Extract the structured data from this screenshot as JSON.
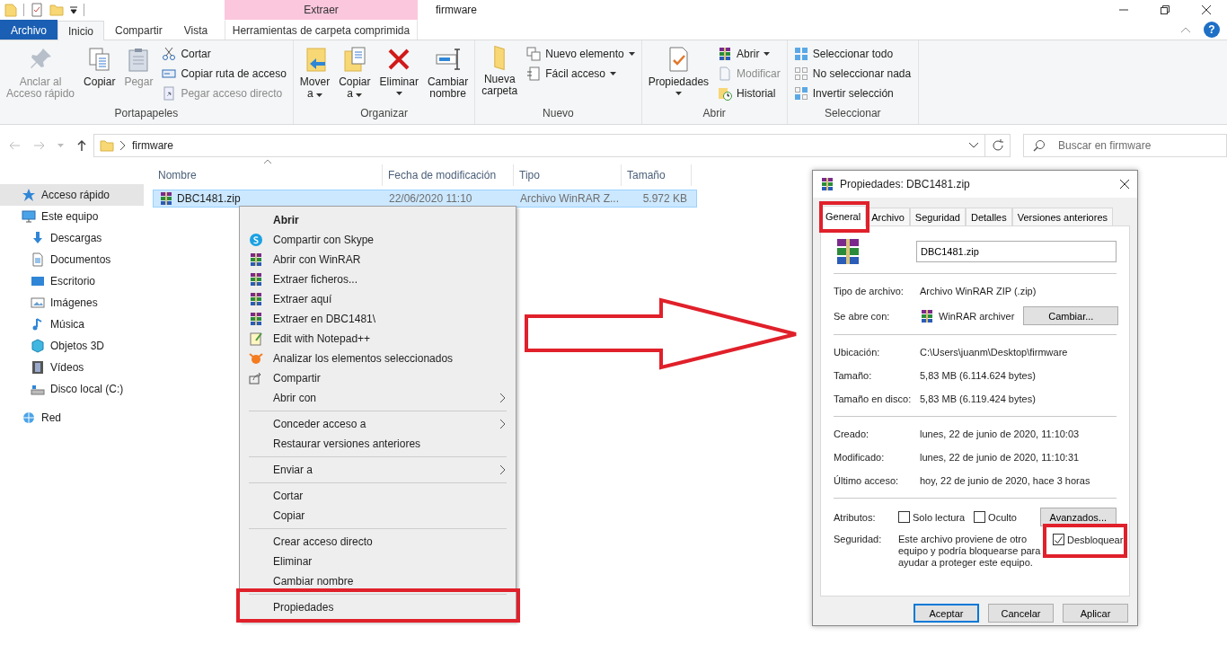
{
  "window": {
    "title": "firmware",
    "tool_tab_group": "Extraer",
    "help_button": "?"
  },
  "ribbon_tabs": [
    {
      "label": "Archivo",
      "kind": "file",
      "selected": false
    },
    {
      "label": "Inicio",
      "kind": "tab",
      "selected": true
    },
    {
      "label": "Compartir",
      "kind": "tab",
      "selected": false
    },
    {
      "label": "Vista",
      "kind": "tab",
      "selected": false
    },
    {
      "label": "Herramientas de carpeta comprimida",
      "kind": "tool",
      "selected": false
    }
  ],
  "ribbon_groups": [
    {
      "name": "Portapapeles",
      "items": [
        {
          "label": "Anclar al\nAcceso rápido",
          "kind": "large",
          "disabled": true,
          "dropdown": false
        },
        {
          "label": "Copiar",
          "kind": "large",
          "disabled": false,
          "dropdown": false
        },
        {
          "label": "Pegar",
          "kind": "large",
          "disabled": true,
          "dropdown": false
        },
        {
          "label": "Cortar",
          "kind": "small",
          "disabled": false,
          "dropdown": false
        },
        {
          "label": "Copiar ruta de acceso",
          "kind": "small",
          "disabled": false,
          "dropdown": false
        },
        {
          "label": "Pegar acceso directo",
          "kind": "small",
          "disabled": true,
          "dropdown": false
        }
      ]
    },
    {
      "name": "Organizar",
      "items": [
        {
          "label": "Mover\na",
          "kind": "large",
          "disabled": false,
          "dropdown": true
        },
        {
          "label": "Copiar\na",
          "kind": "large",
          "disabled": false,
          "dropdown": true
        },
        {
          "label": "Eliminar",
          "kind": "large",
          "disabled": false,
          "dropdown": true
        },
        {
          "label": "Cambiar\nnombre",
          "kind": "large",
          "disabled": false,
          "dropdown": false
        }
      ]
    },
    {
      "name": "Nuevo",
      "items": [
        {
          "label": "Nueva\ncarpeta",
          "kind": "large",
          "disabled": false,
          "dropdown": false
        },
        {
          "label": "Nuevo elemento",
          "kind": "small",
          "disabled": false,
          "dropdown": true
        },
        {
          "label": "Fácil acceso",
          "kind": "small",
          "disabled": false,
          "dropdown": true
        }
      ]
    },
    {
      "name": "Abrir",
      "items": [
        {
          "label": "Propiedades",
          "kind": "large",
          "disabled": false,
          "dropdown": true
        },
        {
          "label": "Abrir",
          "kind": "small",
          "disabled": false,
          "dropdown": true
        },
        {
          "label": "Modificar",
          "kind": "small",
          "disabled": true,
          "dropdown": false
        },
        {
          "label": "Historial",
          "kind": "small",
          "disabled": false,
          "dropdown": false
        }
      ]
    },
    {
      "name": "Seleccionar",
      "items": [
        {
          "label": "Seleccionar todo",
          "kind": "small",
          "disabled": false,
          "dropdown": false
        },
        {
          "label": "No seleccionar nada",
          "kind": "small",
          "disabled": false,
          "dropdown": false
        },
        {
          "label": "Invertir selección",
          "kind": "small",
          "disabled": false,
          "dropdown": false
        }
      ]
    }
  ],
  "address_bar": {
    "path": "firmware"
  },
  "search": {
    "placeholder": "Buscar en firmware"
  },
  "sidebar": {
    "items": [
      {
        "label": "Acceso rápido",
        "selected": true
      },
      {
        "label": "Este equipo",
        "selected": false,
        "children": [
          {
            "label": "Descargas",
            "selected": false
          },
          {
            "label": "Documentos",
            "selected": false
          },
          {
            "label": "Escritorio",
            "selected": false
          },
          {
            "label": "Imágenes",
            "selected": false
          },
          {
            "label": "Música",
            "selected": false
          },
          {
            "label": "Objetos 3D",
            "selected": false
          },
          {
            "label": "Vídeos",
            "selected": false
          },
          {
            "label": "Disco local (C:)",
            "selected": false
          }
        ]
      },
      {
        "label": "Red",
        "selected": false
      }
    ]
  },
  "file_list": {
    "columns": [
      "Nombre",
      "Fecha de modificación",
      "Tipo",
      "Tamaño"
    ],
    "rows": [
      {
        "cells": [
          "DBC1481.zip",
          "22/06/2020 11:10",
          "Archivo WinRAR Z...",
          "5.972 KB"
        ],
        "selected": true
      }
    ]
  },
  "context_menu": {
    "groups": [
      [
        {
          "label": "Abrir",
          "default": true,
          "submenu": false
        },
        {
          "label": "Compartir con Skype",
          "default": false,
          "submenu": false
        },
        {
          "label": "Abrir con WinRAR",
          "default": false,
          "submenu": false
        },
        {
          "label": "Extraer ficheros...",
          "default": false,
          "submenu": false
        },
        {
          "label": "Extraer aquí",
          "default": false,
          "submenu": false
        },
        {
          "label": "Extraer en DBC1481\\",
          "default": false,
          "submenu": false
        },
        {
          "label": "Edit with Notepad++",
          "default": false,
          "submenu": false
        },
        {
          "label": "Analizar los elementos seleccionados",
          "default": false,
          "submenu": false
        },
        {
          "label": "Compartir",
          "default": false,
          "submenu": false
        },
        {
          "label": "Abrir con",
          "default": false,
          "submenu": true
        }
      ],
      [
        {
          "label": "Conceder acceso a",
          "default": false,
          "submenu": true
        },
        {
          "label": "Restaurar versiones anteriores",
          "default": false,
          "submenu": false
        }
      ],
      [
        {
          "label": "Enviar a",
          "default": false,
          "submenu": true
        }
      ],
      [
        {
          "label": "Cortar",
          "default": false,
          "submenu": false
        },
        {
          "label": "Copiar",
          "default": false,
          "submenu": false
        }
      ],
      [
        {
          "label": "Crear acceso directo",
          "default": false,
          "submenu": false
        },
        {
          "label": "Eliminar",
          "default": false,
          "submenu": false
        },
        {
          "label": "Cambiar nombre",
          "default": false,
          "submenu": false
        }
      ],
      [
        {
          "label": "Propiedades",
          "default": false,
          "submenu": false
        }
      ]
    ]
  },
  "properties_dialog": {
    "title": "Propiedades: DBC1481.zip",
    "tabs": [
      {
        "label": "General",
        "selected": true
      },
      {
        "label": "Archivo",
        "selected": false
      },
      {
        "label": "Seguridad",
        "selected": false
      },
      {
        "label": "Detalles",
        "selected": false
      },
      {
        "label": "Versiones anteriores",
        "selected": false
      }
    ],
    "file_name": "DBC1481.zip",
    "sections": [
      [
        {
          "label": "Tipo de archivo:",
          "value": "Archivo WinRAR ZIP (.zip)"
        },
        {
          "label": "Se abre con:",
          "value": "WinRAR archiver",
          "button": "Cambiar..."
        }
      ],
      [
        {
          "label": "Ubicación:",
          "value": "C:\\Users\\juanm\\Desktop\\firmware"
        },
        {
          "label": "Tamaño:",
          "value": "5,83 MB (6.114.624 bytes)"
        },
        {
          "label": "Tamaño en disco:",
          "value": "5,83 MB (6.119.424 bytes)"
        }
      ],
      [
        {
          "label": "Creado:",
          "value": "lunes, 22 de junio de 2020, 11:10:03"
        },
        {
          "label": "Modificado:",
          "value": "lunes, 22 de junio de 2020, 11:10:31"
        },
        {
          "label": "Último acceso:",
          "value": "hoy, 22 de junio de 2020, hace 3 horas"
        }
      ]
    ],
    "attributes": {
      "label": "Atributos:",
      "checkboxes": [
        {
          "label": "Solo lectura",
          "checked": false
        },
        {
          "label": "Oculto",
          "checked": false
        }
      ],
      "button": "Avanzados..."
    },
    "security": {
      "label": "Seguridad:",
      "text": "Este archivo proviene de otro equipo y podría bloquearse para ayudar a proteger este equipo.",
      "checkbox": {
        "label": "Desbloquear",
        "checked": true
      }
    },
    "buttons": [
      {
        "label": "Aceptar",
        "default": true
      },
      {
        "label": "Cancelar",
        "default": false
      },
      {
        "label": "Aplicar",
        "default": false
      }
    ]
  }
}
